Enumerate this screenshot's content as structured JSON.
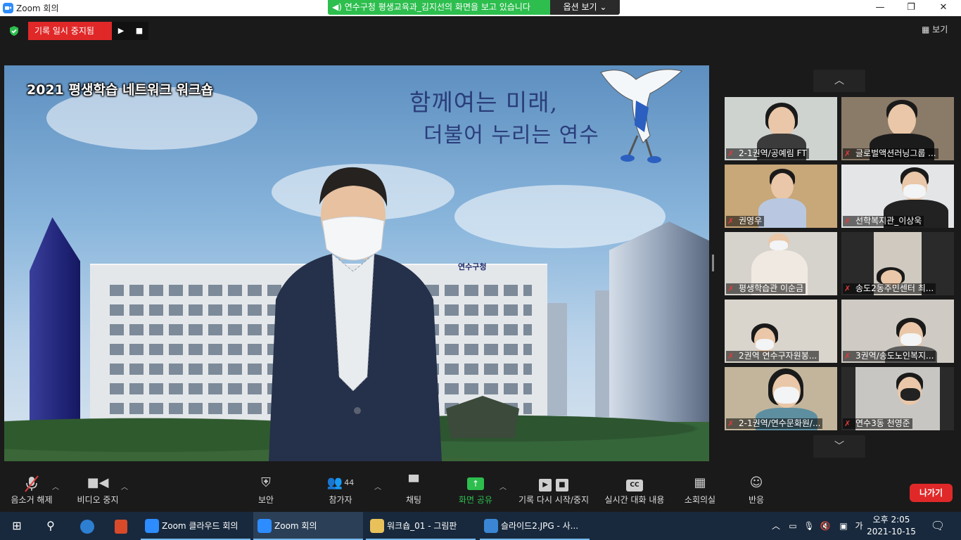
{
  "window": {
    "title": "Zoom 회의",
    "share_banner": "연수구청 평생교육과_김지선의 화면을 보고 있습니다",
    "view_options": "옵션 보기",
    "minimize": "—",
    "restore": "❐",
    "close": "✕"
  },
  "recording": {
    "status": "기록 일시 중지됨",
    "resume_icon": "▶",
    "stop_icon": "■"
  },
  "view_button": "보기",
  "shared_screen": {
    "slide_title": "2021 평생학습 네트워크 워크숍",
    "slogan_line1": "함께여는 미래,",
    "slogan_line2": "더불어 누리는 연수",
    "building_sign": "연수구청"
  },
  "gallery": {
    "up_arrow": "︿",
    "down_arrow": "﹀",
    "participants": [
      {
        "name": "2-1권역/공예림 FT"
      },
      {
        "name": "글로벌액션러닝그룹 ..."
      },
      {
        "name": "권영우"
      },
      {
        "name": "선학복지관_이상욱"
      },
      {
        "name": "평생학습관 이순금"
      },
      {
        "name": "송도2동주민센터 최..."
      },
      {
        "name": "2권역 연수구자원봉..."
      },
      {
        "name": "3권역/송도노인복지..."
      },
      {
        "name": "2-1권역/연수문화원/..."
      },
      {
        "name": "연수3동 천영준"
      }
    ],
    "mic_icon": "muted-mic-icon"
  },
  "toolbar": {
    "unmute": "음소거 해제",
    "stop_video": "비디오 중지",
    "security": "보안",
    "participants": "참가자",
    "participant_count": "44",
    "chat": "채팅",
    "share_screen": "화면 공유",
    "recording": "기록 다시 시작/중지",
    "captions": "실시간 대화 내용",
    "breakout": "소회의실",
    "reactions": "반응",
    "leave": "나가기",
    "cc_icon": "CC",
    "share_color": "#2dbe4e",
    "leave_color": "#e02828"
  },
  "taskbar": {
    "apps": [
      {
        "label": "Zoom 클라우드 회의"
      },
      {
        "label": "Zoom 회의"
      },
      {
        "label": "워크숍_01 - 그림판"
      },
      {
        "label": "슬라이드2.JPG - 사..."
      }
    ],
    "ime": "가",
    "time": "오후 2:05",
    "date": "2021-10-15"
  }
}
